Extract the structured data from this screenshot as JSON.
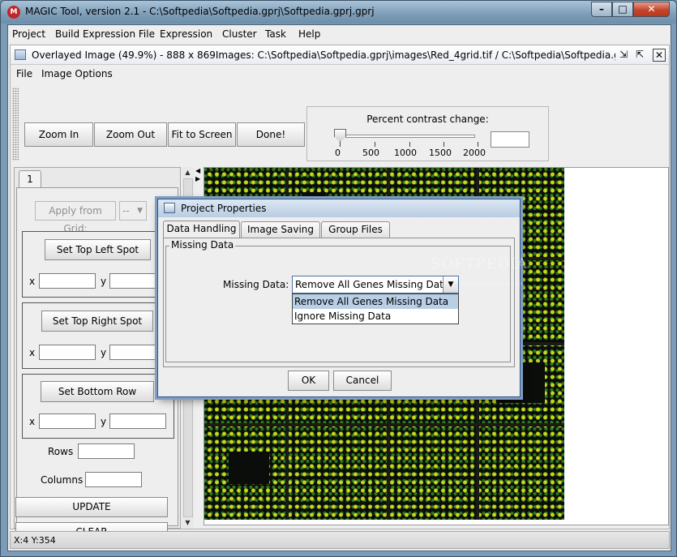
{
  "window": {
    "title": "MAGIC Tool, version 2.1 - C:\\Softpedia\\Softpedia.gprj\\Softpedia.gprj.gprj"
  },
  "menubar": [
    "Project",
    "Build Expression File",
    "Expression",
    "Cluster",
    "Task",
    "Help"
  ],
  "image_frame": {
    "title": "Overlayed Image (49.9%) - 888 x 869Images: C:\\Softpedia\\Softpedia.gprj\\images\\Red_4grid.tif / C:\\Softpedia\\Softpedia.gprj\\ima...",
    "menus": [
      "File",
      "Image Options"
    ]
  },
  "toolbar": {
    "zoom_in": "Zoom In",
    "zoom_out": "Zoom Out",
    "fit": "Fit to Screen",
    "done": "Done!"
  },
  "contrast": {
    "title": "Percent contrast change:",
    "ticks": [
      "0",
      "500",
      "1000",
      "1500",
      "2000"
    ],
    "value": ""
  },
  "left_panel": {
    "tab": "1",
    "apply_from_grid": "Apply from Grid:",
    "apply_combo": "--",
    "set_top_left": "Set Top Left Spot",
    "set_top_right": "Set Top Right Spot",
    "set_bottom_row": "Set Bottom Row",
    "x_label": "x",
    "y_label": "y",
    "rows_label": "Rows",
    "columns_label": "Columns",
    "update": "UPDATE",
    "clear": "CLEAR"
  },
  "status": {
    "coords": "X:4 Y:354"
  },
  "dialog": {
    "title": "Project Properties",
    "tabs": [
      "Data Handling",
      "Image Saving",
      "Group Files"
    ],
    "group_title": "Missing Data",
    "field_label": "Missing Data:",
    "selected": "Remove All Genes Missing Data",
    "options": [
      "Remove All Genes Missing Data",
      "Ignore Missing Data"
    ],
    "ok": "OK",
    "cancel": "Cancel"
  },
  "watermark": {
    "main": "SOFTPEDIA",
    "url": "www.softpedia.com"
  }
}
